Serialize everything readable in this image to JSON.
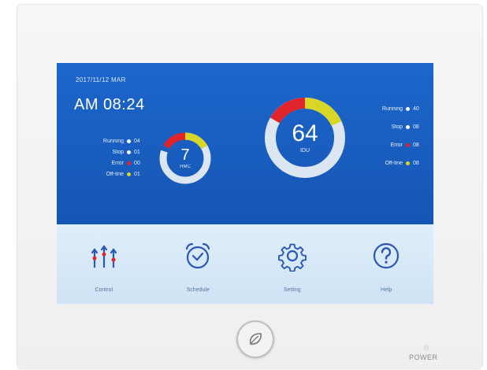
{
  "header": {
    "date": "2017/11/12 MAR",
    "time": "AM 08:24"
  },
  "hmc": {
    "count": "7",
    "label": "HMC",
    "legend": [
      {
        "label": "Running",
        "value": "04",
        "color": "#ffffff"
      },
      {
        "label": "Stop",
        "value": "01",
        "color": "#ffffff"
      },
      {
        "label": "Error",
        "value": "00",
        "color": "#e0242c"
      },
      {
        "label": "Off-line",
        "value": "01",
        "color": "#d8d626"
      }
    ]
  },
  "idu": {
    "count": "64",
    "label": "IDU",
    "legend": [
      {
        "label": "Running",
        "value": "40",
        "color": "#ffffff"
      },
      {
        "label": "Stop",
        "value": "08",
        "color": "#ffffff"
      },
      {
        "label": "Error",
        "value": "08",
        "color": "#e0242c"
      },
      {
        "label": "Off-line",
        "value": "08",
        "color": "#d8d626"
      }
    ]
  },
  "menu": {
    "items": [
      {
        "label": "Control",
        "icon": "sliders-icon"
      },
      {
        "label": "Schedule",
        "icon": "alarm-clock-icon"
      },
      {
        "label": "Setting",
        "icon": "gear-icon"
      },
      {
        "label": "Help",
        "icon": "question-icon"
      }
    ]
  },
  "device": {
    "power_label": "POWER"
  },
  "colors": {
    "screen_blue": "#1a5fc0",
    "ring_light": "#dbe6f2",
    "ring_red": "#e0242c",
    "ring_yellow": "#d8d626",
    "icon_blue": "#2a57b8"
  }
}
